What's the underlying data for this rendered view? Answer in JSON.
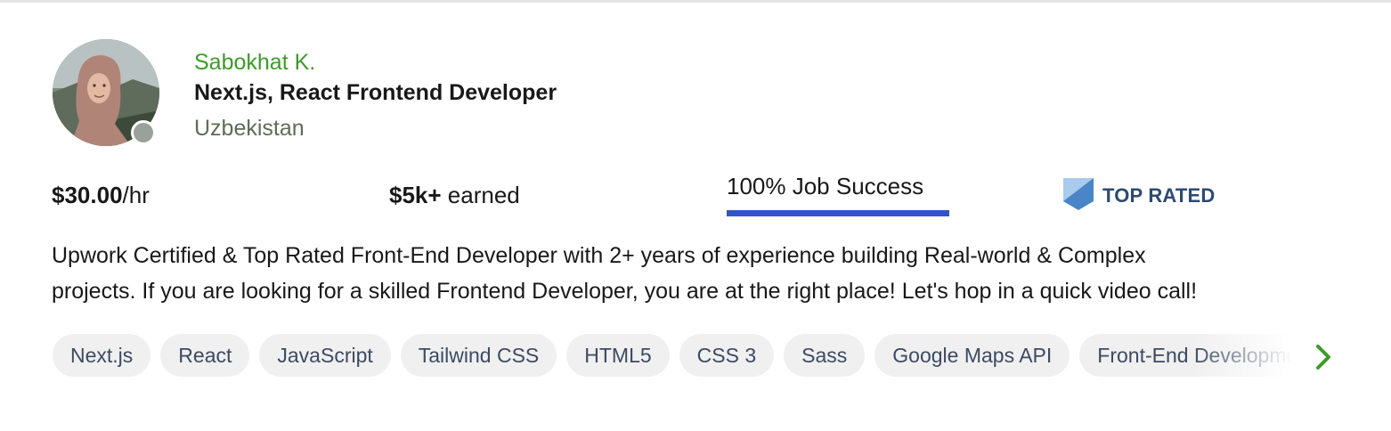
{
  "profile": {
    "name": "Sabokhat K.",
    "title": "Next.js, React Frontend Developer",
    "location": "Uzbekistan",
    "online_status": "offline"
  },
  "stats": {
    "rate_value": "$30.00",
    "rate_unit": "/hr",
    "earned_value": "$5k+",
    "earned_label": " earned",
    "job_success_label": "100% Job Success",
    "job_success_percent": 100,
    "badge_label": "TOP RATED"
  },
  "description": {
    "line1": "Upwork Certified & Top Rated Front-End Developer with 2+ years of experience building Real-world & Complex",
    "line2": "projects. If you are looking for a skilled Frontend Developer, you are at the right place! Let's hop in a quick video call!"
  },
  "skills": [
    "Next.js",
    "React",
    "JavaScript",
    "Tailwind CSS",
    "HTML5",
    "CSS 3",
    "Sass",
    "Google Maps API",
    "Front-End Development"
  ],
  "colors": {
    "name": "#3e9b2b",
    "job_success_bar": "#2f55c7",
    "badge_text": "#2e4a72",
    "badge_icon": "#4a86c7",
    "chevron": "#3e9b2b",
    "skill_bg": "#eff0ef"
  },
  "icons": {
    "badge": "top-rated-badge-icon",
    "next": "chevron-right-icon",
    "status": "status-dot-icon"
  }
}
